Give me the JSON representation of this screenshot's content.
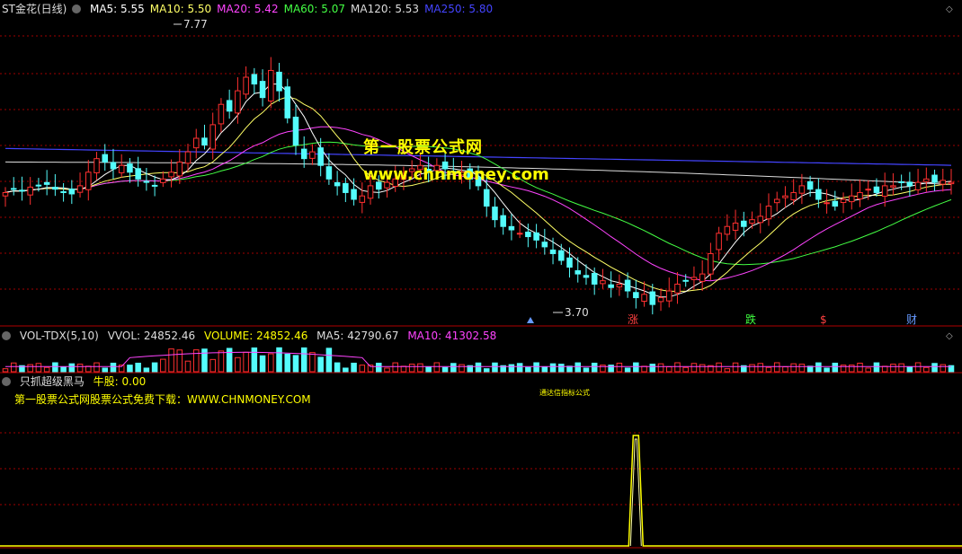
{
  "panel_main": {
    "title": "ST金花(日线)",
    "ma": [
      {
        "label": "MA5: 5.55",
        "color": "#ffffff"
      },
      {
        "label": "MA10: 5.50",
        "color": "#ffff66"
      },
      {
        "label": "MA20: 5.42",
        "color": "#ff44ff"
      },
      {
        "label": "MA60: 5.07",
        "color": "#44ff44"
      },
      {
        "label": "MA120: 5.53",
        "color": "#dddddd"
      },
      {
        "label": "MA250: 5.80",
        "color": "#4444ff"
      }
    ],
    "high_label": "7.77",
    "low_label": "3.70",
    "event_marks": [
      "涨",
      "跌",
      "$",
      "财"
    ],
    "watermark1": "第一股票公式网",
    "watermark2": "www.chnmoney.com"
  },
  "panel_vol": {
    "title": "VOL-TDX(5,10)",
    "vol": "VVOL: 24852.46",
    "volume": "VOLUME: 24852.46",
    "ma5": "MA5: 42790.67",
    "ma10": "MA10: 41302.58"
  },
  "panel_ind": {
    "title": "只抓超级黑马",
    "value": "牛股: 0.00",
    "note": "第一股票公式网股票公式免费下载：WWW.CHNMONEY.COM",
    "tiny_text": "通达信指标公式"
  },
  "colors": {
    "up": "#ff3030",
    "down": "#54fcfc",
    "ma5": "#ffffff",
    "ma10": "#ffff66",
    "ma20": "#ff44ff",
    "ma60": "#44ff44",
    "ma120": "#dddddd",
    "ma250": "#4444ff",
    "grid": "#a00000"
  },
  "chart_data": {
    "type": "candlestick",
    "ylim": [
      3.5,
      8.0
    ],
    "high": 7.77,
    "low": 3.7,
    "close_series": [
      5.4,
      5.45,
      5.42,
      5.48,
      5.5,
      5.52,
      5.45,
      5.4,
      5.38,
      5.5,
      5.7,
      5.9,
      5.85,
      5.75,
      5.8,
      5.7,
      5.6,
      5.55,
      5.5,
      5.6,
      5.7,
      5.85,
      6.0,
      6.2,
      6.1,
      6.4,
      6.7,
      6.6,
      6.9,
      7.1,
      7.0,
      6.8,
      7.2,
      6.9,
      6.5,
      6.1,
      5.9,
      6.0,
      5.8,
      5.6,
      5.5,
      5.4,
      5.3,
      5.35,
      5.5,
      5.45,
      5.55,
      5.6,
      5.65,
      5.75,
      5.8,
      5.7,
      5.8,
      5.75,
      5.7,
      5.7,
      5.6,
      5.5,
      5.2,
      5.0,
      4.9,
      4.85,
      4.8,
      4.75,
      4.7,
      4.6,
      4.5,
      4.4,
      4.3,
      4.2,
      4.15,
      4.05,
      4.1,
      4.0,
      4.05,
      3.95,
      3.85,
      3.9,
      3.75,
      3.85,
      3.95,
      4.05,
      4.1,
      4.15,
      4.2,
      4.5,
      4.8,
      4.9,
      4.95,
      4.9,
      5.0,
      5.05,
      5.2,
      5.3,
      5.35,
      5.4,
      5.5,
      5.45,
      5.3,
      5.25,
      5.2,
      5.3,
      5.35,
      5.4,
      5.45,
      5.4,
      5.5,
      5.5,
      5.55,
      5.5,
      5.55,
      5.6,
      5.55,
      5.58,
      5.55
    ],
    "ma5_last": 5.55,
    "ma10_last": 5.5,
    "ma20_last": 5.42,
    "ma60_last": 5.07,
    "ma120_last": 5.53,
    "ma250_last": 5.8,
    "volume_last": 24852.46,
    "vol_ma5_last": 42790.67,
    "vol_ma10_last": 41302.58,
    "indicator_signal_index": 76,
    "indicator_last": 0.0
  }
}
